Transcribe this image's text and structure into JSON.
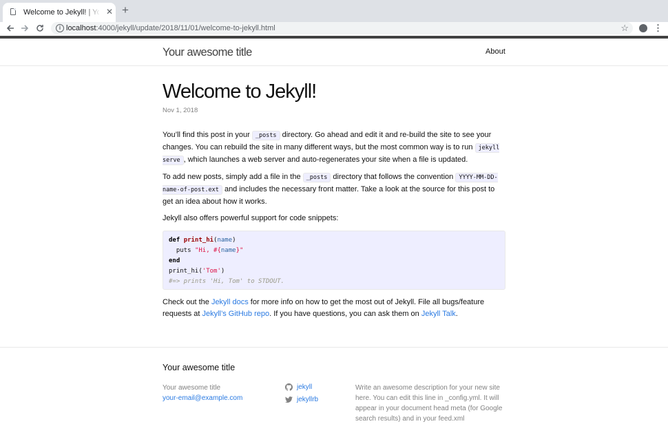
{
  "browser": {
    "tab_title": "Welcome to Jekyll! | Your awesome title",
    "tab_close": "✕",
    "new_tab": "+",
    "url_host": "localhost",
    "url_path": ":4000/jekyll/update/2018/11/01/welcome-to-jekyll.html"
  },
  "site": {
    "title": "Your awesome title",
    "nav": {
      "about": "About"
    }
  },
  "post": {
    "title": "Welcome to Jekyll!",
    "date": "Nov 1, 2018",
    "p1": {
      "t1": "You’ll find this post in your ",
      "c1": "_posts",
      "t2": " directory. Go ahead and edit it and re-build the site to see your changes. You can rebuild the site in many different ways, but the most common way is to run ",
      "c2": "jekyll serve",
      "t3": ", which launches a web server and auto-regenerates your site when a file is updated."
    },
    "p2": {
      "t1": "To add new posts, simply add a file in the ",
      "c1": "_posts",
      "t2": " directory that follows the convention ",
      "c2": "YYYY-MM-DD-name-of-post.ext",
      "t3": " and includes the necessary front matter. Take a look at the source for this post to get an idea about how it works."
    },
    "p3": "Jekyll also offers powerful support for code snippets:",
    "code": {
      "l1_kw": "def",
      "l1_fn": "print_hi",
      "l1_open": "(",
      "l1_arg": "name",
      "l1_close": ")",
      "l2_indent": "  puts ",
      "l2_str1": "\"Hi, #{",
      "l2_var": "name",
      "l2_str2": "}\"",
      "l3_kw": "end",
      "l4_call": "print_hi(",
      "l4_str": "'Tom'",
      "l4_close": ")",
      "l5_cmt": "#=> prints 'Hi, Tom' to STDOUT."
    },
    "p4": {
      "t1": "Check out the ",
      "link1": "Jekyll docs",
      "t2": " for more info on how to get the most out of Jekyll. File all bugs/feature requests at ",
      "link2": "Jekyll’s GitHub repo",
      "t3": ". If you have questions, you can ask them on ",
      "link3": "Jekyll Talk",
      "t4": "."
    }
  },
  "footer": {
    "heading": "Your awesome title",
    "name": "Your awesome title",
    "email": "your-email@example.com",
    "github": "jekyll",
    "twitter": "jekyllrb",
    "description": "Write an awesome description for your new site here. You can edit this line in _config.yml. It will appear in your document head meta (for Google search results) and in your feed.xml"
  },
  "colors": {
    "link": "#2a7ae2",
    "meta": "#828282",
    "code_bg": "#eeeeff"
  }
}
